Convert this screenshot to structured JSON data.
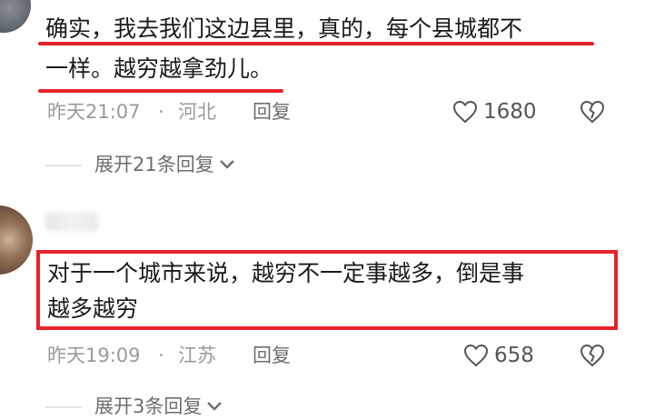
{
  "comments": [
    {
      "text_line1": "确实，我去我们这边县里，真的，每个县城都不",
      "text_line2": "一样。越穷越拿劲儿。",
      "time": "昨天21:07",
      "separator": "·",
      "location": "河北",
      "reply_label": "回复",
      "likes": "1680",
      "expand_label": "展开21条回复"
    },
    {
      "text_line1": "对于一个城市来说，越穷不一定事越多，倒是事",
      "text_line2": "越多越穷",
      "time": "昨天19:09",
      "separator": "·",
      "location": "江苏",
      "reply_label": "回复",
      "likes": "658",
      "expand_label": "展开3条回复"
    }
  ],
  "icons": {
    "like": "heart-outline-icon",
    "dislike": "broken-heart-icon",
    "expand": "chevron-down-icon"
  },
  "colors": {
    "highlight": "#e5232b",
    "meta_text": "#9a9a9a",
    "body_text": "#1a1a1a"
  }
}
